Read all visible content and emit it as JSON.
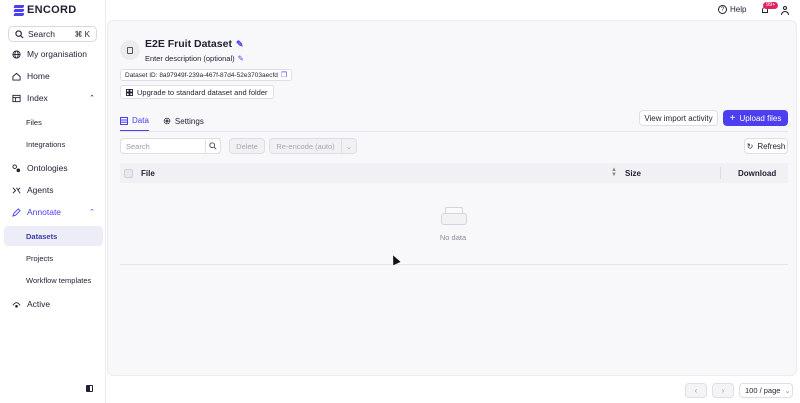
{
  "brand": {
    "name": "encord"
  },
  "sidebar": {
    "search_label": "Search",
    "search_shortcut": "⌘ K",
    "items": [
      {
        "label": "My organisation"
      },
      {
        "label": "Home"
      },
      {
        "label": "Index"
      },
      {
        "label": "Files"
      },
      {
        "label": "Integrations"
      },
      {
        "label": "Ontologies"
      },
      {
        "label": "Agents"
      },
      {
        "label": "Annotate"
      },
      {
        "label": "Datasets"
      },
      {
        "label": "Projects"
      },
      {
        "label": "Workflow templates"
      },
      {
        "label": "Active"
      }
    ]
  },
  "topbar": {
    "help_label": "Help",
    "notification_count": "99+"
  },
  "dataset": {
    "title": "E2E Fruit Dataset",
    "description_placeholder": "Enter description (optional)",
    "id_label": "Dataset ID: 8a97949f-239a-467f-87d4-52e3703aecfd",
    "upgrade_label": "Upgrade to standard dataset and folder"
  },
  "tabs": [
    {
      "label": "Data",
      "active": true
    },
    {
      "label": "Settings",
      "active": false
    }
  ],
  "actions": {
    "view_import": "View import activity",
    "upload": "Upload files",
    "search_placeholder": "Search",
    "delete": "Delete",
    "reencode": "Re-encode (auto)",
    "refresh": "Refresh"
  },
  "table": {
    "columns": [
      "File",
      "Size",
      "Download"
    ],
    "empty_text": "No data"
  },
  "pagination": {
    "page_size": "100 / page"
  },
  "colors": {
    "accent": "#4b3ff0",
    "badge": "#e0245e"
  }
}
